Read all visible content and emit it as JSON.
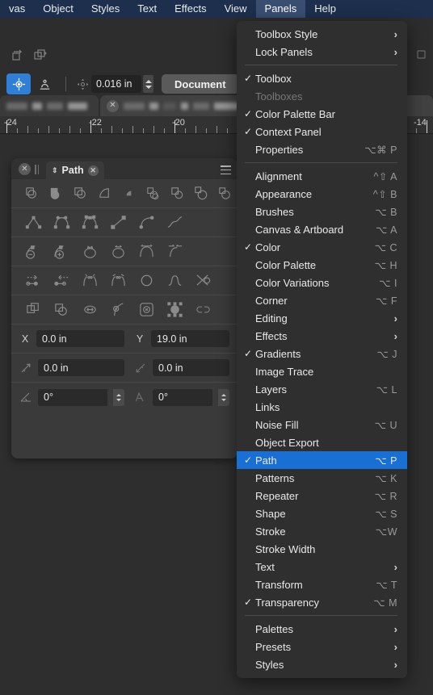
{
  "menubar": {
    "items": [
      {
        "label": "vas",
        "active": false
      },
      {
        "label": "Object",
        "active": false
      },
      {
        "label": "Styles",
        "active": false
      },
      {
        "label": "Text",
        "active": false
      },
      {
        "label": "Effects",
        "active": false
      },
      {
        "label": "View",
        "active": false
      },
      {
        "label": "Panels",
        "active": true
      },
      {
        "label": "Help",
        "active": false
      }
    ]
  },
  "toolbar": {
    "snap_value": "0.016 in",
    "document_button": "Document",
    "layer_button": "ayer ("
  },
  "ruler": {
    "unit_labels": [
      "-24",
      "-22",
      "-20",
      "-14"
    ]
  },
  "panel": {
    "tab_label": "Path",
    "fields": {
      "x_label": "X",
      "x_value": "0.0 in",
      "y_label": "Y",
      "y_value": "19.0 in",
      "len1_value": "0.0 in",
      "len2_value": "0.0 in",
      "angle1_value": "0°",
      "angle2_value": "0°"
    }
  },
  "menu": {
    "items": [
      {
        "label": "Toolbox Style",
        "checked": false,
        "submenu": true,
        "shortcut": "",
        "selected": false,
        "disabled": false
      },
      {
        "label": "Lock Panels",
        "checked": false,
        "submenu": true,
        "shortcut": "",
        "selected": false,
        "disabled": false
      },
      {
        "separator": true
      },
      {
        "label": "Toolbox",
        "checked": true,
        "submenu": false,
        "shortcut": "",
        "selected": false,
        "disabled": false
      },
      {
        "label": "Toolboxes",
        "checked": false,
        "submenu": false,
        "shortcut": "",
        "selected": false,
        "disabled": true
      },
      {
        "label": "Color Palette Bar",
        "checked": true,
        "submenu": false,
        "shortcut": "",
        "selected": false,
        "disabled": false
      },
      {
        "label": "Context Panel",
        "checked": true,
        "submenu": false,
        "shortcut": "",
        "selected": false,
        "disabled": false
      },
      {
        "label": "Properties",
        "checked": false,
        "submenu": false,
        "shortcut": "⌥⌘ P",
        "selected": false,
        "disabled": false
      },
      {
        "separator": true
      },
      {
        "label": "Alignment",
        "checked": false,
        "submenu": false,
        "shortcut": "^⇧ A",
        "selected": false,
        "disabled": false
      },
      {
        "label": "Appearance",
        "checked": false,
        "submenu": false,
        "shortcut": "^⇧ B",
        "selected": false,
        "disabled": false
      },
      {
        "label": "Brushes",
        "checked": false,
        "submenu": false,
        "shortcut": "⌥ B",
        "selected": false,
        "disabled": false
      },
      {
        "label": "Canvas & Artboard",
        "checked": false,
        "submenu": false,
        "shortcut": "⌥ A",
        "selected": false,
        "disabled": false
      },
      {
        "label": "Color",
        "checked": true,
        "submenu": false,
        "shortcut": "⌥ C",
        "selected": false,
        "disabled": false
      },
      {
        "label": "Color Palette",
        "checked": false,
        "submenu": false,
        "shortcut": "⌥ H",
        "selected": false,
        "disabled": false
      },
      {
        "label": "Color Variations",
        "checked": false,
        "submenu": false,
        "shortcut": "⌥ I",
        "selected": false,
        "disabled": false
      },
      {
        "label": "Corner",
        "checked": false,
        "submenu": false,
        "shortcut": "⌥ F",
        "selected": false,
        "disabled": false
      },
      {
        "label": "Editing",
        "checked": false,
        "submenu": true,
        "shortcut": "",
        "selected": false,
        "disabled": false
      },
      {
        "label": "Effects",
        "checked": false,
        "submenu": true,
        "shortcut": "",
        "selected": false,
        "disabled": false
      },
      {
        "label": "Gradients",
        "checked": true,
        "submenu": false,
        "shortcut": "⌥ J",
        "selected": false,
        "disabled": false
      },
      {
        "label": "Image Trace",
        "checked": false,
        "submenu": false,
        "shortcut": "",
        "selected": false,
        "disabled": false
      },
      {
        "label": "Layers",
        "checked": false,
        "submenu": false,
        "shortcut": "⌥ L",
        "selected": false,
        "disabled": false
      },
      {
        "label": "Links",
        "checked": false,
        "submenu": false,
        "shortcut": "",
        "selected": false,
        "disabled": false
      },
      {
        "label": "Noise Fill",
        "checked": false,
        "submenu": false,
        "shortcut": "⌥ U",
        "selected": false,
        "disabled": false
      },
      {
        "label": "Object Export",
        "checked": false,
        "submenu": false,
        "shortcut": "",
        "selected": false,
        "disabled": false
      },
      {
        "label": "Path",
        "checked": true,
        "submenu": false,
        "shortcut": "⌥ P",
        "selected": true,
        "disabled": false
      },
      {
        "label": "Patterns",
        "checked": false,
        "submenu": false,
        "shortcut": "⌥ K",
        "selected": false,
        "disabled": false
      },
      {
        "label": "Repeater",
        "checked": false,
        "submenu": false,
        "shortcut": "⌥ R",
        "selected": false,
        "disabled": false
      },
      {
        "label": "Shape",
        "checked": false,
        "submenu": false,
        "shortcut": "⌥ S",
        "selected": false,
        "disabled": false
      },
      {
        "label": "Stroke",
        "checked": false,
        "submenu": false,
        "shortcut": "⌥W",
        "selected": false,
        "disabled": false
      },
      {
        "label": "Stroke Width",
        "checked": false,
        "submenu": false,
        "shortcut": "",
        "selected": false,
        "disabled": false
      },
      {
        "label": "Text",
        "checked": false,
        "submenu": true,
        "shortcut": "",
        "selected": false,
        "disabled": false
      },
      {
        "label": "Transform",
        "checked": false,
        "submenu": false,
        "shortcut": "⌥ T",
        "selected": false,
        "disabled": false
      },
      {
        "label": "Transparency",
        "checked": true,
        "submenu": false,
        "shortcut": "⌥ M",
        "selected": false,
        "disabled": false
      },
      {
        "separator": true
      },
      {
        "label": "Palettes",
        "checked": false,
        "submenu": true,
        "shortcut": "",
        "selected": false,
        "disabled": false
      },
      {
        "label": "Presets",
        "checked": false,
        "submenu": true,
        "shortcut": "",
        "selected": false,
        "disabled": false
      },
      {
        "label": "Styles",
        "checked": false,
        "submenu": true,
        "shortcut": "",
        "selected": false,
        "disabled": false
      }
    ]
  },
  "colors": {
    "menubar_bg": "#1d2f4d",
    "menubar_active": "#3a4e72",
    "menu_bg": "#2f2f2f",
    "selection_blue": "#1a6fd4",
    "tool_selected": "#2f7fd6",
    "panel_bg": "#3a3a3a"
  }
}
